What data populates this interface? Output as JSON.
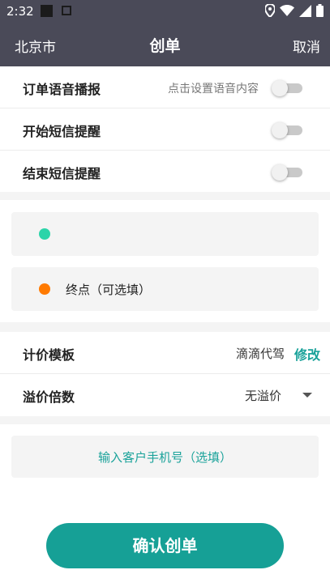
{
  "status_bar": {
    "time": "2:32",
    "icons": [
      "media-square-icon",
      "notification-icon",
      "location-icon",
      "wifi-icon",
      "signal-icon",
      "battery-icon"
    ]
  },
  "nav": {
    "city": "北京市",
    "title": "创单",
    "cancel": "取消",
    "background": "#4a4a58"
  },
  "settings": {
    "voice": {
      "label": "订单语音播报",
      "hint": "点击设置语音内容",
      "enabled": false
    },
    "sms_start": {
      "label": "开始短信提醒",
      "enabled": false
    },
    "sms_end": {
      "label": "结束短信提醒",
      "enabled": false
    }
  },
  "locations": {
    "start": {
      "text": "",
      "dot_color": "#2bd4a9"
    },
    "end": {
      "text": "终点（可选填）",
      "dot_color": "#ff7a00"
    }
  },
  "pricing": {
    "template_label": "计价模板",
    "template_value": "滴滴代驾",
    "template_edit": "修改",
    "premium_label": "溢价倍数",
    "premium_value": "无溢价"
  },
  "phone": {
    "placeholder": "输入客户手机号（选填）"
  },
  "confirm": {
    "label": "确认创单",
    "color": "#16a096"
  },
  "accent_color": "#1aa29a"
}
